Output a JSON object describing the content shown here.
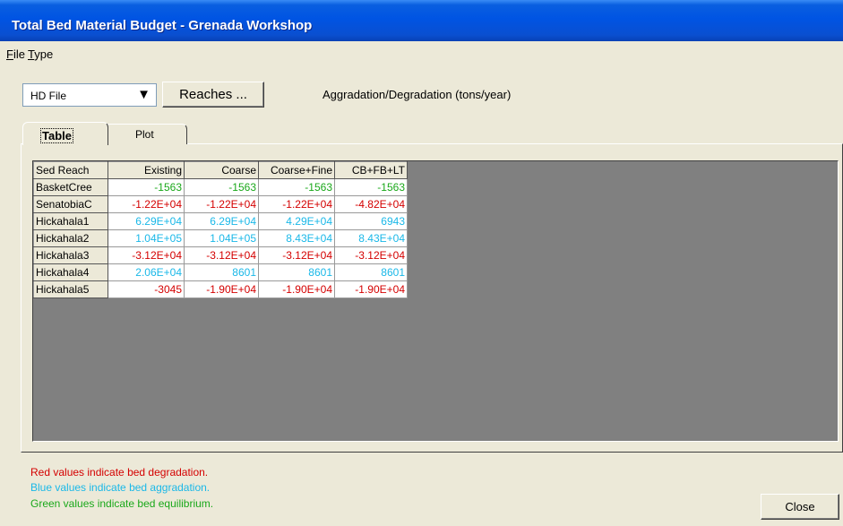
{
  "window": {
    "title": "Total Bed Material Budget - Grenada Workshop"
  },
  "menu": [
    {
      "label": "File",
      "mnemonic": "F",
      "rest": "ile"
    },
    {
      "label": "Type",
      "mnemonic": "T",
      "rest": "ype"
    }
  ],
  "toolbar": {
    "file_type": "HD File",
    "reaches_label": "Reaches ...",
    "header_text": "Aggradation/Degradation (tons/year)"
  },
  "tabs": [
    {
      "label": "Table",
      "selected": true
    },
    {
      "label": "Plot",
      "selected": false
    }
  ],
  "colors": {
    "degradation": "#d40000",
    "aggradation": "#1ab8e8",
    "equilibrium": "#1aa81a"
  },
  "table": {
    "columns": [
      "Sed Reach",
      "Existing",
      "Coarse",
      "Coarse+Fine",
      "CB+FB+LT"
    ],
    "rows": [
      {
        "name": "BasketCree",
        "values": [
          "-1563",
          "-1563",
          "-1563",
          "-1563"
        ],
        "status": [
          "equilibrium",
          "equilibrium",
          "equilibrium",
          "equilibrium"
        ]
      },
      {
        "name": "SenatobiaC",
        "values": [
          "-1.22E+04",
          "-1.22E+04",
          "-1.22E+04",
          "-4.82E+04"
        ],
        "status": [
          "degradation",
          "degradation",
          "degradation",
          "degradation"
        ]
      },
      {
        "name": "Hickahala1",
        "values": [
          "6.29E+04",
          "6.29E+04",
          "4.29E+04",
          "6943"
        ],
        "status": [
          "aggradation",
          "aggradation",
          "aggradation",
          "aggradation"
        ]
      },
      {
        "name": "Hickahala2",
        "values": [
          "1.04E+05",
          "1.04E+05",
          "8.43E+04",
          "8.43E+04"
        ],
        "status": [
          "aggradation",
          "aggradation",
          "aggradation",
          "aggradation"
        ]
      },
      {
        "name": "Hickahala3",
        "values": [
          "-3.12E+04",
          "-3.12E+04",
          "-3.12E+04",
          "-3.12E+04"
        ],
        "status": [
          "degradation",
          "degradation",
          "degradation",
          "degradation"
        ]
      },
      {
        "name": "Hickahala4",
        "values": [
          "2.06E+04",
          "8601",
          "8601",
          "8601"
        ],
        "status": [
          "aggradation",
          "aggradation",
          "aggradation",
          "aggradation"
        ]
      },
      {
        "name": "Hickahala5",
        "values": [
          "-3045",
          "-1.90E+04",
          "-1.90E+04",
          "-1.90E+04"
        ],
        "status": [
          "degradation",
          "degradation",
          "degradation",
          "degradation"
        ]
      }
    ]
  },
  "legend": {
    "red": "Red values indicate bed degradation.",
    "blue": "Blue values indicate bed aggradation.",
    "green": "Green values indicate bed equilibrium."
  },
  "close_label": "Close"
}
